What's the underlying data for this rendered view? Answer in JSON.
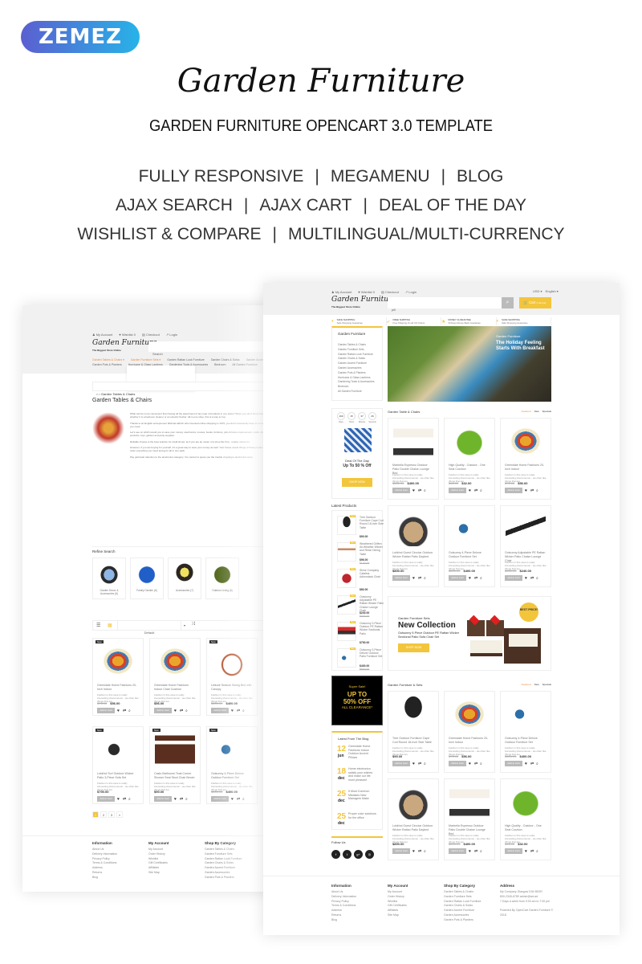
{
  "brand": {
    "logo": "ZEMEZ",
    "gradient": [
      "#5b5fd0",
      "#27b3e8"
    ]
  },
  "title": "Garden Furniture",
  "subtitle": "GARDEN FURNITURE OPENCART 3.0 TEMPLATE",
  "features": [
    [
      "FULLY RESPONSIVE",
      "MEGAMENU",
      "BLOG"
    ],
    [
      "AJAX SEARCH",
      "AJAX CART",
      "DEAL OF THE DAY"
    ],
    [
      "WISHLIST & COMPARE",
      "MULTILINGUAL/MULTI-CURRENCY"
    ]
  ],
  "colors": {
    "accent": "#f3c53b",
    "orange": "#f08a3c",
    "header_bg": "#f1f1f1"
  },
  "shop": {
    "top_links": [
      "My Account",
      "Wishlist 0",
      "Checkout",
      "Login"
    ],
    "logo": "Garden Furniture",
    "tagline": "The Biggest Store Online",
    "currency": "USD ▾",
    "language": "English ▾",
    "search_value": "pill",
    "search_placeholder": "Search",
    "cart_label": "Cart",
    "cart_count": "0 item(s)",
    "benefits": [
      {
        "title": "SAFE SHOPPING",
        "text": "Safe Shopping Guarantee",
        "icon": "shield-icon"
      },
      {
        "title": "FREE SHIPPING",
        "text": "Free Shipping On All US Orders",
        "icon": "rocket-icon"
      },
      {
        "title": "MONEY GUARANTEE",
        "text": "30 Days Money Back Guarantee",
        "icon": "star-icon"
      },
      {
        "title": "SAFE SHOPPING",
        "text": "Safe Shopping Guarantee",
        "icon": "shield-icon"
      }
    ],
    "category_title": "Garden Furniture",
    "categories": [
      "Garden Tables & Chairs",
      "Garden Furniture Sets",
      "Garden Rattan Look Furniture",
      "Garden Chairs & Sofas",
      "Garden Accent Furniture",
      "Garden Accessories",
      "Garden Pots & Planters",
      "Hurricane & Glass Lanterns",
      "Gardening Tools & Accessories",
      "Bedroom",
      "All Garden Furniture"
    ],
    "hero": {
      "kicker": "Garden Furniture",
      "heading": "The Holiday Feeling Starts With Breakfast"
    },
    "deal": {
      "countdown": [
        {
          "v": "169",
          "l": "Days"
        },
        {
          "v": "15",
          "l": "Hours"
        },
        {
          "v": "37",
          "l": "Minutes"
        },
        {
          "v": "29",
          "l": "Seconds"
        }
      ],
      "title": "Deal Of The Day",
      "offer": "Up To 50 % Off",
      "button": "SHOP NOW"
    },
    "sections": [
      {
        "title": "Garden Table & Chairs",
        "tabs": [
          "Featured",
          "New",
          "Specials"
        ],
        "products": [
          {
            "name": "Marbella Espresso Outdoor Patio Double Chaise Lounge Bed",
            "old": "$500.00",
            "price": "$400.00",
            "img": "umbrella"
          },
          {
            "name": "High Quality - Outdoor - One Seat Cushion",
            "old": "$46.00",
            "price": "$32.00",
            "img": "green-cushion"
          },
          {
            "name": "Greendale Home Fashions 20-Inch Indoor",
            "old": "$76.00",
            "price": "$56.00",
            "img": "floral-cushion"
          },
          {
            "name": "Lokkhol Guest Circular Outdoor Wicker Rattan Patio Daybed",
            "old": "",
            "price": "$800.00",
            "img": "daybed"
          },
          {
            "name": "Outsunny 4-Piece Deluxe Outdoor Furniture Set",
            "old": "$500.00",
            "price": "$400.00",
            "img": "outdoor-set"
          },
          {
            "name": "Outsunny Adjustable PE Rattan Wicker Patio Chaise Lounge Chair",
            "old": "$300.00",
            "price": "$240.00",
            "img": "lounger"
          }
        ]
      },
      {
        "title": "Garden Furniture & Sets",
        "tabs": [
          "Featured",
          "New",
          "Specials"
        ],
        "products": [
          {
            "name": "Tree Outdoor Furniture Cape Cod Round 18-Inch Side Table",
            "old": "",
            "price": "$90.00",
            "img": "side-table"
          },
          {
            "name": "Greendale Home Fashions 20-Inch Indoor",
            "old": "$76.00",
            "price": "$56.00",
            "img": "floral-cushion"
          },
          {
            "name": "Outsunny 4-Piece Deluxe Outdoor Furniture Set",
            "old": "$500.00",
            "price": "$400.00",
            "img": "outdoor-set"
          },
          {
            "name": "Lokkhol Guest Circular Outdoor Wicker Rattan Patio Daybed",
            "old": "",
            "price": "$800.00",
            "img": "daybed"
          },
          {
            "name": "Marbella Espresso Outdoor Patio Double Chaise Lounge Bed",
            "old": "$500.00",
            "price": "$400.00",
            "img": "umbrella"
          },
          {
            "name": "High Quality - Outdoor - One Seat Cushion",
            "old": "$46.00",
            "price": "$32.00",
            "img": "green-cushion"
          }
        ]
      }
    ],
    "product_desc": "Fashion in this case is really interesting phenomenon - we often like things that are",
    "add_to_cart": "Add to Cart",
    "latest_title": "Latest Products",
    "latest": [
      {
        "name": "Tree Outdoor Furniture Cape Cod Round 18-Inch Side Table",
        "price": "$90.00",
        "old": "",
        "img": "side-table"
      },
      {
        "name": "Weathered Griffen All-Weather Wicker and Resin Dining Table",
        "price": "$96.00",
        "old": "$120.00",
        "img": "bench"
      },
      {
        "name": "Shine Company Catalina Adirondack Chair",
        "price": "$80.00",
        "old": "",
        "img": "red-chair"
      },
      {
        "name": "Outsunny Adjustable PE Rattan Wicker Patio Chaise Lounge Chair",
        "price": "$240.00",
        "old": "$300.00",
        "img": "lounger"
      },
      {
        "name": "Outsunny 3-Piece Outdoor PE Rattan Wicker Sectional Patio",
        "price": "$750.00",
        "old": "",
        "img": "sectional"
      },
      {
        "name": "Outsunny 3-Piece Deluxe Outdoor Patio Furniture Set",
        "price": "$400.00",
        "old": "$500.00",
        "img": "outdoor-set"
      }
    ],
    "new_badge": "New",
    "collection": {
      "kicker": "Garden Furniture Sets",
      "heading": "New Collection",
      "text": "Outsunny 9-Piece Outdoor PE Rattan Wicker Sectional Patio Sofa Chair Set",
      "button": "SHOP NOW",
      "badge": "BEST PRICE!"
    },
    "super_sale": {
      "kicker": "Super Sale!",
      "line1": "UP TO",
      "line2": "50% OFF",
      "line3": "ALL CLEARANCE*"
    },
    "blog_title": "Latest From The Blog",
    "blog": [
      {
        "day": "12",
        "month": "jun",
        "text": "Greendale Home Fashions Indoor Outdoor Accent Pillows"
      },
      {
        "day": "18",
        "month": "dec",
        "text": "Home electronics satisfy your wishes and make our life more pleasant"
      },
      {
        "day": "25",
        "month": "dec",
        "text": "5 Most Common Mistakes New Managers Make"
      },
      {
        "day": "25",
        "month": "dec",
        "text": "Proper color solutions for the office"
      }
    ],
    "follow_title": "Follow Us",
    "social": [
      "facebook-icon",
      "twitter-icon",
      "google-plus-icon",
      "instagram-icon"
    ],
    "footer": [
      {
        "title": "Information",
        "items": [
          "About Us",
          "Delivery Information",
          "Privacy Policy",
          "Terms & Conditions",
          "Address",
          "Returns",
          "Blog"
        ]
      },
      {
        "title": "My Account",
        "items": [
          "My Account",
          "Order History",
          "Wishlist",
          "Gift Certificates",
          "Affiliates",
          "Site Map"
        ]
      },
      {
        "title": "Shop By Category",
        "items": [
          "Garden Tables & Chairs",
          "Garden Furniture Sets",
          "Garden Rattan Look Furniture",
          "Garden Chairs & Sofas",
          "Garden Accent Furniture",
          "Garden Accessories",
          "Garden Pots & Planters"
        ]
      },
      {
        "title": "Address",
        "items": [
          "My Company Glasgow D04 89GR",
          "800-2345-6789 admin@wd.ad",
          "7 Days a week from 9:00 am to 7:00 pm",
          "",
          "Powered By OpenCart Garden Furniture ©",
          "2018"
        ]
      }
    ]
  },
  "category_page": {
    "nav": [
      "Garden Tables & Chairs ▾",
      "Garden Furniture Sets ▾",
      "Garden Rattan Look Furniture",
      "Garden Chairs & Sofas",
      "Garden Accent Furniture",
      "Garden Pots & Planters",
      "Hurricane & Glass Lanterns",
      "Gardening Tools & Accessories",
      "Bedroom",
      "All Garden Furniture"
    ],
    "breadcrumb": "Garden Tables & Chairs",
    "heading": "Garden Tables & Chairs",
    "description": [
      "What can be more convenient than having all the assortment of any type of products in one place? When you don't shop looking for a specific brand, whether it is a bedroom cleaner or an eclectic fresher. All-in-one shop, this is a way to buy.",
      "Thanks to an English entrepreneur Michael Aldrich who invented online shopping in 1979, you don't necessarily have to run around a mall to find what you need.",
      "Let's see on which would you to save your money: electronics, movies, books, furniture, jobs & home improvement, crafts. Also you have on how you products, toys, garden and party supplies.",
      "Reliable choose is the best solution for small shops: as if you are an owner of a shop like that - retailer stores for.",
      "However, if you are buying for yourself, it's a great way to save your money as well. Your house needs things of those problem purposes, you simply order everything you need and get it all in one pack.",
      "Pay particular attention to the electronics category. You cannot to spare you the trouble of going to electronics store."
    ],
    "refine_title": "Refine Search",
    "refine": [
      {
        "name": "Garden Decor & Accessories (6)",
        "img": "daybed-blue"
      },
      {
        "name": "Family Garden (6)",
        "img": "blue-cushion"
      },
      {
        "name": "Accessories (7)",
        "img": "basket"
      },
      {
        "name": "Outdoor Living (6)",
        "img": "olive-cushion"
      }
    ],
    "sort": "Default",
    "products": [
      {
        "name": "Greendale Home Fashions 20-Inch Indoor",
        "old": "$76.00",
        "price": "$56.00",
        "img": "floral-cushion",
        "badge": "New"
      },
      {
        "name": "Greendale Home Fashions Indoor Chair Cushion",
        "old": "",
        "price": "$56.00",
        "img": "floral-cushion",
        "badge": ""
      },
      {
        "name": "Leisure Season Swing Bed with Canopy",
        "old": "$500.00",
        "price": "$400.00",
        "img": "swing",
        "badge": "New"
      },
      {
        "name": "Lokkhol Turf Outdoor Wicker Patio 3-Piece Sofa Set",
        "old": "",
        "price": "$700.00",
        "img": "sectional-dark",
        "badge": "New"
      },
      {
        "name": "Casto Bathroom Teak Corner Shower Seat Stool Chair Bench",
        "old": "",
        "price": "$90.00",
        "img": "side-table-wood",
        "badge": "New"
      },
      {
        "name": "Outsunny 4-Piece Deluxe Outdoor Furniture Set",
        "old": "$500.00",
        "price": "$400.00",
        "img": "outdoor-set",
        "badge": "New"
      }
    ],
    "pages": [
      "1",
      "2",
      "3",
      "»"
    ],
    "footer": [
      {
        "title": "Information",
        "items": [
          "About Us",
          "Delivery Information",
          "Privacy Policy",
          "Terms & Conditions",
          "Address",
          "Returns",
          "Blog"
        ]
      },
      {
        "title": "My Account",
        "items": [
          "My Account",
          "Order History",
          "Wishlist",
          "Gift Certificates",
          "Affiliates",
          "Site Map"
        ]
      },
      {
        "title": "Shop By Category",
        "items": [
          "Garden Tables & Chairs",
          "Garden Furniture Sets",
          "Garden Rattan Look Furniture",
          "Garden Chairs & Sofas",
          "Garden Accent Furniture",
          "Garden Accessories",
          "Garden Pots & Planters"
        ]
      }
    ]
  }
}
